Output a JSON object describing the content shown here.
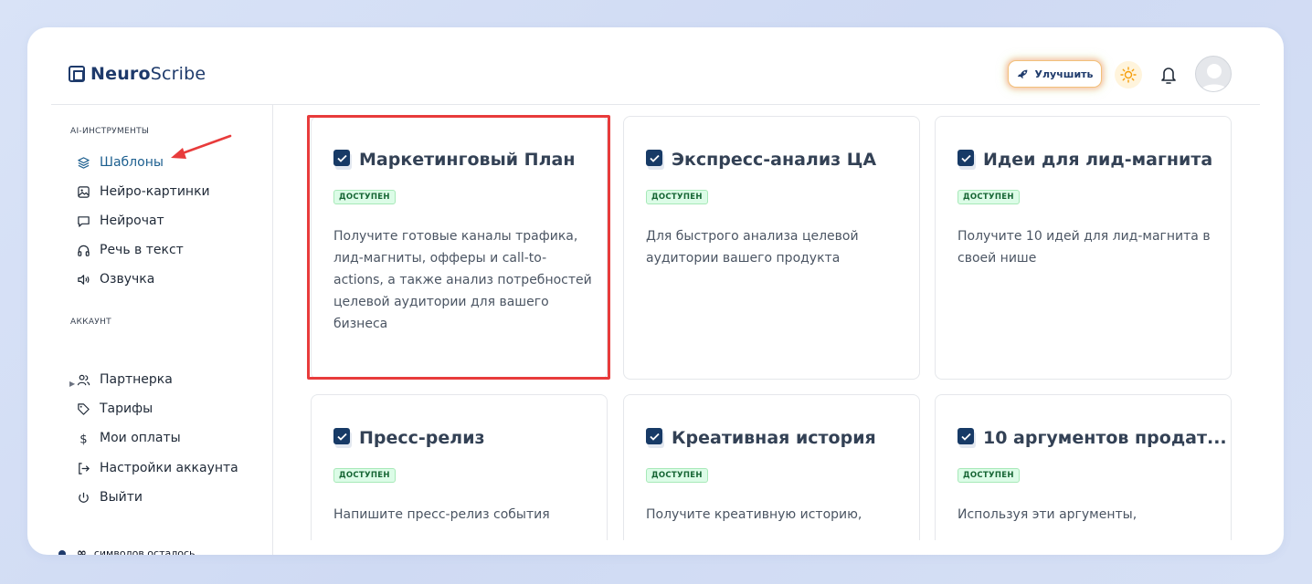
{
  "app": {
    "brand_bold": "Neuro",
    "brand_regular": "Scribe",
    "upgrade_label": "Улучшить"
  },
  "sidebar": {
    "section_tools": "AI-ИНСТРУМЕНТЫ",
    "tools": [
      {
        "label": "Шаблоны",
        "icon": "layers-icon",
        "active": true
      },
      {
        "label": "Нейро-картинки",
        "icon": "image-icon"
      },
      {
        "label": "Нейрочат",
        "icon": "chat-icon"
      },
      {
        "label": "Речь в текст",
        "icon": "headphones-icon"
      },
      {
        "label": "Озвучка",
        "icon": "speaker-icon"
      }
    ],
    "section_account": "АККАУНТ",
    "account": [
      {
        "label": "Партнерка",
        "icon": "users-icon"
      },
      {
        "label": "Тарифы",
        "icon": "tag-icon"
      },
      {
        "label": "Мои оплаты",
        "icon": "dollar-icon"
      },
      {
        "label": "Настройки аккаунта",
        "icon": "logout-arrow-icon"
      },
      {
        "label": "Выйти",
        "icon": "power-icon"
      }
    ],
    "symbols_value": "∞",
    "symbols_label": "символов осталось"
  },
  "templates": [
    {
      "title": "Маркетинговый План",
      "badge": "ДОСТУПЕН",
      "description": "Получите готовые каналы трафика, лид-магниты, офферы и call-to-actions, а также анализ потребностей целевой аудитории для вашего бизнеса"
    },
    {
      "title": "Экспресс-анализ ЦА",
      "badge": "ДОСТУПЕН",
      "description": "Для быстрого анализа целевой аудитории вашего продукта"
    },
    {
      "title": "Идеи для лид-магнита",
      "badge": "ДОСТУПЕН",
      "description": "Получите 10 идей для лид-магнита в своей нише"
    },
    {
      "title": "Пресс-релиз",
      "badge": "ДОСТУПЕН",
      "description": "Напишите пресс-релиз события"
    },
    {
      "title": "Креативная история",
      "badge": "ДОСТУПЕН",
      "description": "Получите креативную историю,"
    },
    {
      "title": "10 аргументов продат...",
      "badge": "ДОСТУПЕН",
      "description": "Используя эти аргументы,"
    }
  ],
  "colors": {
    "accent": "#1d5f8f",
    "brand": "#1e3a6b",
    "highlight": "#e83b3b",
    "badge_bg": "#dcfce7"
  }
}
